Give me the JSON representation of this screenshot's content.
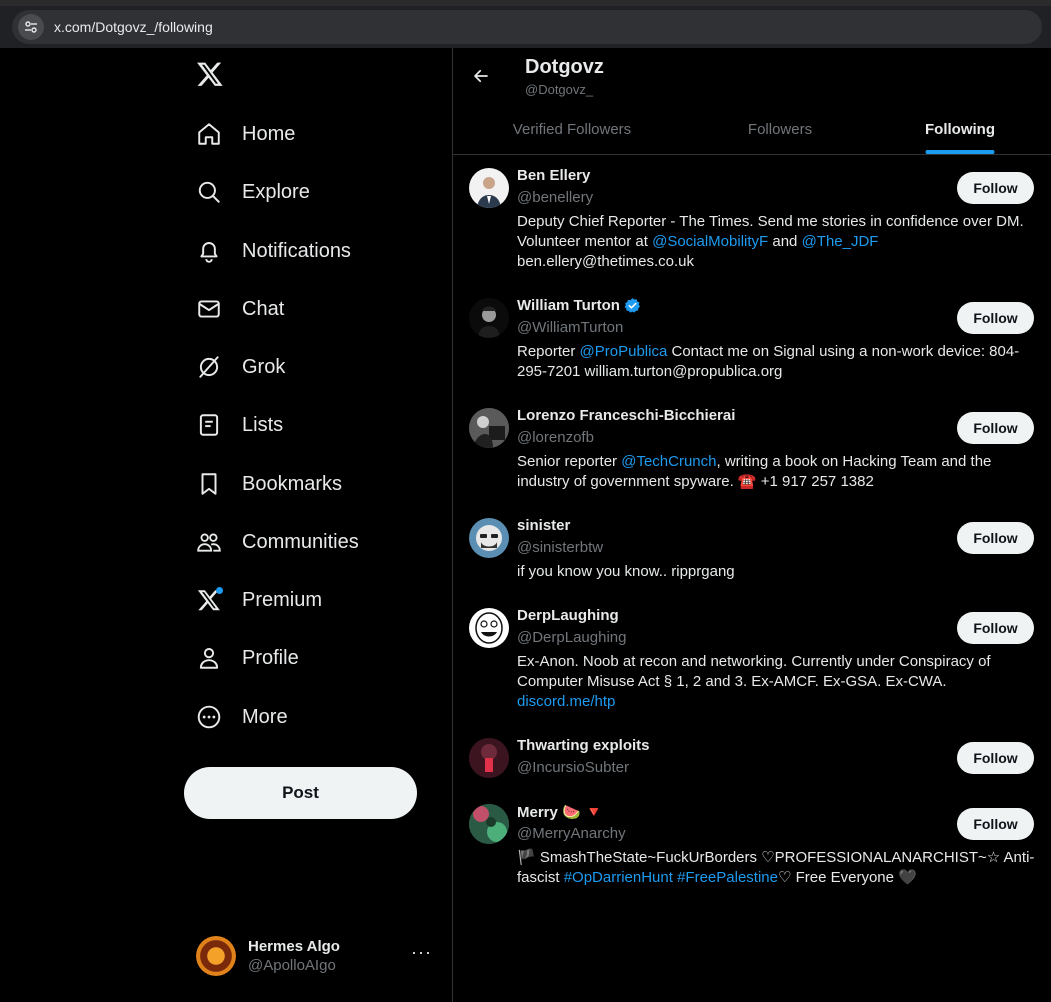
{
  "browser": {
    "url": "x.com/Dotgovz_/following"
  },
  "nav": [
    {
      "label": "Home",
      "icon": "home-icon"
    },
    {
      "label": "Explore",
      "icon": "search-icon"
    },
    {
      "label": "Notifications",
      "icon": "bell-icon"
    },
    {
      "label": "Chat",
      "icon": "envelope-icon"
    },
    {
      "label": "Grok",
      "icon": "grok-icon"
    },
    {
      "label": "Lists",
      "icon": "list-icon"
    },
    {
      "label": "Bookmarks",
      "icon": "bookmark-icon"
    },
    {
      "label": "Communities",
      "icon": "people-icon"
    },
    {
      "label": "Premium",
      "icon": "x-premium-icon"
    },
    {
      "label": "Profile",
      "icon": "person-icon"
    },
    {
      "label": "More",
      "icon": "more-circle-icon"
    }
  ],
  "post_label": "Post",
  "account": {
    "name": "Hermes Algo",
    "handle": "@ApolloAIgo",
    "more": "···"
  },
  "profile": {
    "name": "Dotgovz",
    "handle": "@Dotgovz_"
  },
  "tabs": [
    {
      "label": "Verified Followers",
      "active": false
    },
    {
      "label": "Followers",
      "active": false
    },
    {
      "label": "Following",
      "active": true
    }
  ],
  "follow_label": "Follow",
  "users": [
    {
      "name": "Ben Ellery",
      "handle": "@benellery",
      "verified": false,
      "bio": [
        {
          "t": "Deputy Chief Reporter - The Times. Send me stories in confidence over DM. Volunteer mentor at "
        },
        {
          "t": "@SocialMobilityF",
          "link": true
        },
        {
          "t": " and "
        },
        {
          "t": "@The_JDF",
          "link": true
        },
        {
          "t": " ben.ellery@thetimes.co.uk"
        }
      ]
    },
    {
      "name": "William Turton",
      "handle": "@WilliamTurton",
      "verified": true,
      "bio": [
        {
          "t": "Reporter "
        },
        {
          "t": "@ProPublica",
          "link": true
        },
        {
          "t": " Contact me on Signal using a non-work device: 804-295-7201 william.turton@propublica.org"
        }
      ]
    },
    {
      "name": "Lorenzo Franceschi-Bicchierai",
      "handle": "@lorenzofb",
      "verified": false,
      "bio": [
        {
          "t": "Senior reporter "
        },
        {
          "t": "@TechCrunch",
          "link": true
        },
        {
          "t": ", writing a book on Hacking Team and the industry of government spyware. ☎️ +1 917 257 1382"
        }
      ]
    },
    {
      "name": "sinister",
      "handle": "@sinisterbtw",
      "verified": false,
      "bio": [
        {
          "t": "if you know you know.. ripprgang"
        }
      ]
    },
    {
      "name": "DerpLaughing",
      "handle": "@DerpLaughing",
      "verified": false,
      "bio": [
        {
          "t": "Ex-Anon. Noob at recon and networking. Currently under Conspiracy of Computer Misuse Act § 1, 2 and 3. Ex-AMCF. Ex-GSA. Ex-CWA. "
        },
        {
          "t": "discord.me/htp",
          "link": true
        }
      ]
    },
    {
      "name": "Thwarting exploits",
      "handle": "@IncursioSubter",
      "verified": false,
      "bio": []
    },
    {
      "name": "Merry 🍉 🔻",
      "handle": "@MerryAnarchy",
      "verified": false,
      "bio": [
        {
          "t": "🏴 SmashTheState~FuckUrBorders ♡PROFESSIONALANARCHIST~☆ Anti-fascist "
        },
        {
          "t": "#OpDarrienHunt",
          "link": true
        },
        {
          "t": " "
        },
        {
          "t": "#FreePalestine",
          "link": true
        },
        {
          "t": "♡ Free Everyone 🖤"
        }
      ]
    }
  ],
  "colors": {
    "accent": "#1d9bf0",
    "background": "#000000",
    "muted": "#71767b",
    "text": "#e7e9ea"
  }
}
